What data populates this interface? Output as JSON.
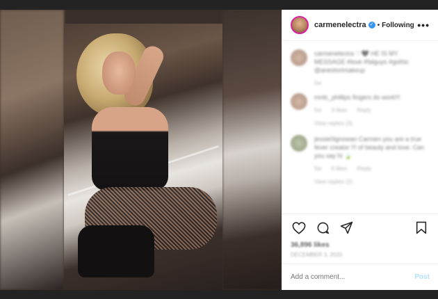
{
  "post": {
    "username": "carmenelectra",
    "follow_separator": "•",
    "follow_label": "Following",
    "more_label": "•••"
  },
  "comments": [
    {
      "user": "carmenelectra",
      "text": "carmenelectra ♡🖤 HE IS MY MESSAGE #love #falguys #gothic @anestorimakeup",
      "meta": [
        "5w"
      ],
      "replies": ""
    },
    {
      "user": "mrdc_phillips",
      "text": "mrdc_phillips fingers do work!!!",
      "meta": [
        "5w",
        "3 likes",
        "Reply"
      ],
      "replies": "View replies (3)"
    },
    {
      "user": "jessie0ignowan",
      "text": "jessie0ignowan Carmen you are a true fever creator !!! of beauty and love. Can you say hi 🍃",
      "meta": [
        "5w",
        "6 likes",
        "Reply"
      ],
      "replies": "View replies (2)"
    }
  ],
  "likes": "36,896 likes",
  "date": "DECEMBER 3, 2020",
  "add_comment": {
    "placeholder": "Add a comment...",
    "post_label": "Post"
  },
  "icons": {
    "heart": "heart-icon",
    "comment": "comment-icon",
    "share": "share-icon",
    "save": "bookmark-icon",
    "verified": "verified-badge-icon"
  },
  "colors": {
    "background": "#232323",
    "verified": "#3897f0",
    "post_disabled": "#b2dffc",
    "story_ring": "#d6249f"
  }
}
